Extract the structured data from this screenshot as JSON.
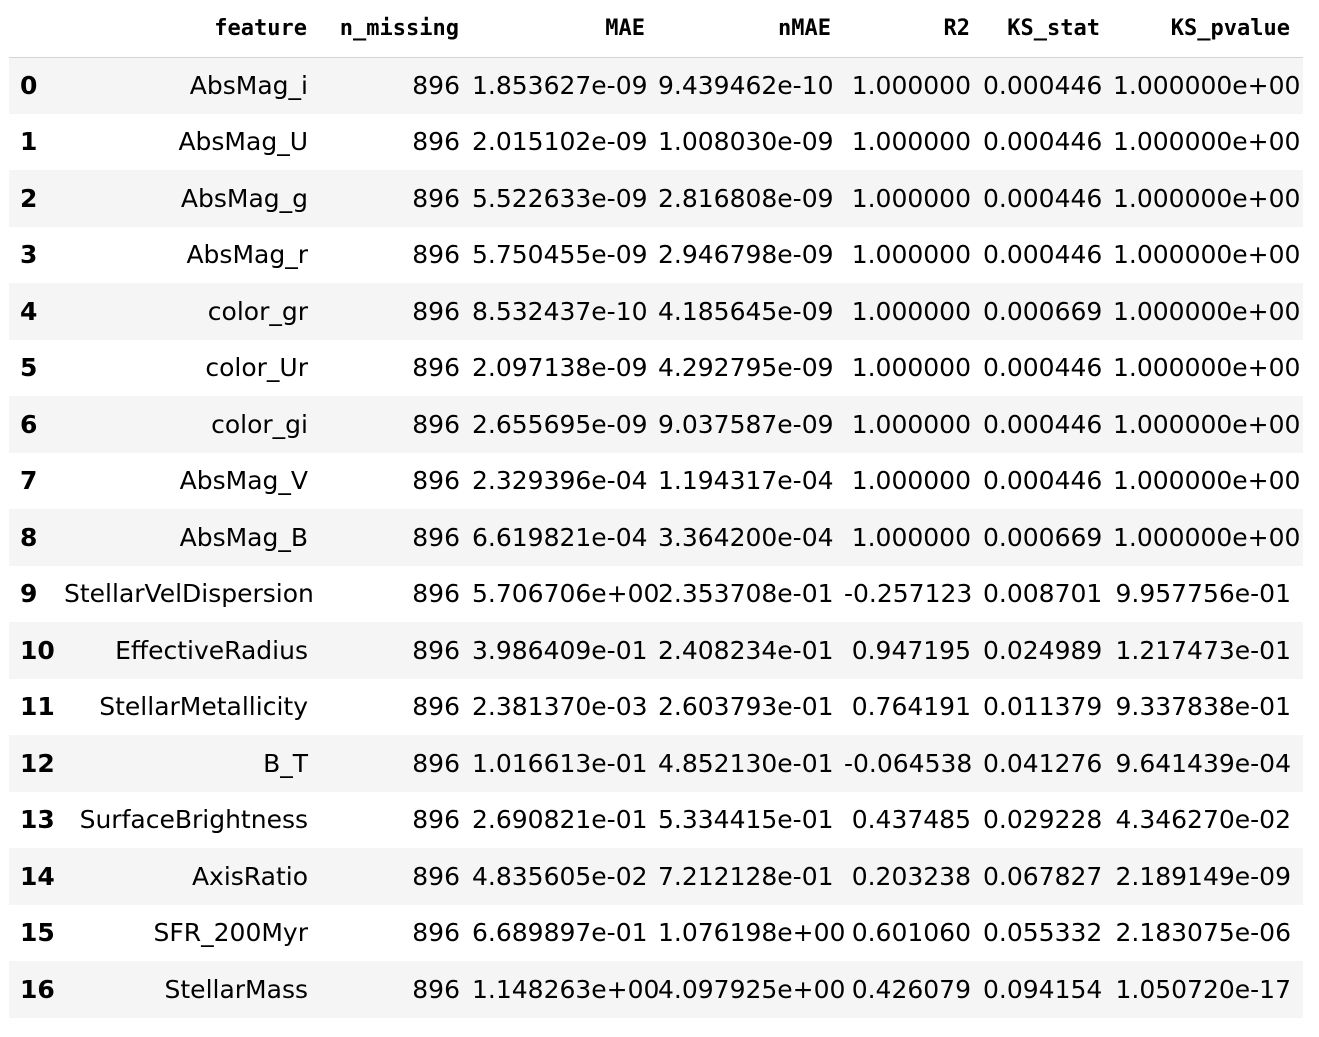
{
  "table": {
    "columns": [
      "",
      "feature",
      "n_missing",
      "MAE",
      "nMAE",
      "R2",
      "KS_stat",
      "KS_pvalue"
    ],
    "rows": [
      [
        "0",
        "AbsMag_i",
        "896",
        "1.853627e-09",
        "9.439462e-10",
        "1.000000",
        "0.000446",
        "1.000000e+00"
      ],
      [
        "1",
        "AbsMag_U",
        "896",
        "2.015102e-09",
        "1.008030e-09",
        "1.000000",
        "0.000446",
        "1.000000e+00"
      ],
      [
        "2",
        "AbsMag_g",
        "896",
        "5.522633e-09",
        "2.816808e-09",
        "1.000000",
        "0.000446",
        "1.000000e+00"
      ],
      [
        "3",
        "AbsMag_r",
        "896",
        "5.750455e-09",
        "2.946798e-09",
        "1.000000",
        "0.000446",
        "1.000000e+00"
      ],
      [
        "4",
        "color_gr",
        "896",
        "8.532437e-10",
        "4.185645e-09",
        "1.000000",
        "0.000669",
        "1.000000e+00"
      ],
      [
        "5",
        "color_Ur",
        "896",
        "2.097138e-09",
        "4.292795e-09",
        "1.000000",
        "0.000446",
        "1.000000e+00"
      ],
      [
        "6",
        "color_gi",
        "896",
        "2.655695e-09",
        "9.037587e-09",
        "1.000000",
        "0.000446",
        "1.000000e+00"
      ],
      [
        "7",
        "AbsMag_V",
        "896",
        "2.329396e-04",
        "1.194317e-04",
        "1.000000",
        "0.000446",
        "1.000000e+00"
      ],
      [
        "8",
        "AbsMag_B",
        "896",
        "6.619821e-04",
        "3.364200e-04",
        "1.000000",
        "0.000669",
        "1.000000e+00"
      ],
      [
        "9",
        "StellarVelDispersion",
        "896",
        "5.706706e+00",
        "2.353708e-01",
        "-0.257123",
        "0.008701",
        "9.957756e-01"
      ],
      [
        "10",
        "EffectiveRadius",
        "896",
        "3.986409e-01",
        "2.408234e-01",
        "0.947195",
        "0.024989",
        "1.217473e-01"
      ],
      [
        "11",
        "StellarMetallicity",
        "896",
        "2.381370e-03",
        "2.603793e-01",
        "0.764191",
        "0.011379",
        "9.337838e-01"
      ],
      [
        "12",
        "B_T",
        "896",
        "1.016613e-01",
        "4.852130e-01",
        "-0.064538",
        "0.041276",
        "9.641439e-04"
      ],
      [
        "13",
        "SurfaceBrightness",
        "896",
        "2.690821e-01",
        "5.334415e-01",
        "0.437485",
        "0.029228",
        "4.346270e-02"
      ],
      [
        "14",
        "AxisRatio",
        "896",
        "4.835605e-02",
        "7.212128e-01",
        "0.203238",
        "0.067827",
        "2.189149e-09"
      ],
      [
        "15",
        "SFR_200Myr",
        "896",
        "6.689897e-01",
        "1.076198e+00",
        "0.601060",
        "0.055332",
        "2.183075e-06"
      ],
      [
        "16",
        "StellarMass",
        "896",
        "1.148263e+00",
        "4.097925e+00",
        "0.426079",
        "0.094154",
        "1.050720e-17"
      ]
    ]
  }
}
